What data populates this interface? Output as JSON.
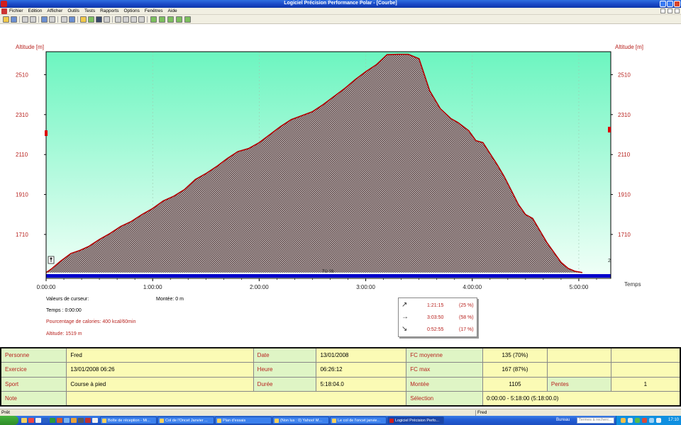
{
  "window": {
    "title": "Logiciel Précision Performance Polar - [Courbe]"
  },
  "menu": [
    "Fichier",
    "Edition",
    "Afficher",
    "Outils",
    "Tests",
    "Rapports",
    "Options",
    "Fenêtres",
    "Aide"
  ],
  "toolbar_icons": [
    "open-icon",
    "save-icon",
    "print-icon",
    "copy-icon",
    "heart-icon",
    "tools-icon",
    "calendar-icon",
    "folder-icon",
    "chart-icon",
    "bar-chart-icon",
    "grid-icon",
    "zoom-icon",
    "zoom-in-icon",
    "zoom-out-icon",
    "image-icon",
    "graph-icon",
    "graph-edit-icon",
    "graph-plus-icon",
    "graph-down-icon",
    "graph-up-icon"
  ],
  "chart_data": {
    "type": "area",
    "ylabel_left": "Altitude [m]",
    "ylabel_right": "Altitude [m]",
    "xlabel": "Temps",
    "yticks": [
      1710,
      1910,
      2110,
      2310,
      2510
    ],
    "xticks": [
      "0:00:00",
      "1:00:00",
      "2:00:00",
      "3:00:00",
      "4:00:00",
      "5:00:00"
    ],
    "ylim": [
      1490,
      2625
    ],
    "xlim_minutes": [
      0,
      318
    ],
    "bar_label": "70 %",
    "right_marker": "2",
    "colors": {
      "line": "#b30000",
      "fill": "#8a7070",
      "bg_top": "#6cf5c0",
      "bg_bottom": "#f2fff8",
      "bar": "#0000cc"
    },
    "series": [
      {
        "x_minutes": [
          0,
          3,
          8,
          14,
          19,
          24,
          30,
          36,
          42,
          48,
          54,
          60,
          66,
          72,
          78,
          84,
          90,
          96,
          102,
          108,
          114,
          120,
          126,
          132,
          138,
          144,
          150,
          156,
          162,
          168,
          174,
          180,
          186,
          192,
          198,
          204,
          210,
          216,
          222,
          228,
          232,
          238,
          242,
          246,
          250,
          254,
          258,
          262,
          266,
          270,
          274,
          278,
          282,
          286,
          290,
          294,
          298,
          302,
          306,
          310,
          314,
          316,
          317
        ],
        "altitude_m": [
          1519,
          1537,
          1575,
          1615,
          1630,
          1650,
          1685,
          1715,
          1750,
          1775,
          1810,
          1840,
          1878,
          1902,
          1935,
          1985,
          2015,
          2050,
          2090,
          2125,
          2140,
          2170,
          2210,
          2250,
          2285,
          2305,
          2325,
          2360,
          2400,
          2440,
          2485,
          2525,
          2560,
          2610,
          2612,
          2612,
          2590,
          2430,
          2340,
          2290,
          2270,
          2230,
          2180,
          2170,
          2115,
          2060,
          2000,
          1930,
          1860,
          1810,
          1790,
          1730,
          1670,
          1620,
          1570,
          1540,
          1525,
          1519
        ]
      }
    ]
  },
  "cursor": {
    "heading": "Valeurs de curseur:",
    "montee": "Montée: 0 m",
    "temps": "Temps : 0:00:00",
    "calories": "Pourcentage de calories: 400 kcal/60min",
    "altitude": "Altitude: 1519 m"
  },
  "slopes": [
    {
      "icon": "up-arrow-icon",
      "time": "1:21:15",
      "pct": "(25 %)"
    },
    {
      "icon": "right-arrow-icon",
      "time": "3:03:50",
      "pct": "(58 %)"
    },
    {
      "icon": "down-arrow-icon",
      "time": "0:52:55",
      "pct": "(17 %)"
    }
  ],
  "summary": {
    "personne_label": "Personne",
    "personne": "Fred",
    "date_label": "Date",
    "date": "13/01/2008",
    "fc_moy_label": "FC moyenne",
    "fc_moy": "135 (70%)",
    "exercice_label": "Exercice",
    "exercice": "13/01/2008 06:26",
    "heure_label": "Heure",
    "heure": "06:26:12",
    "fc_max_label": "FC max",
    "fc_max": "167 (87%)",
    "sport_label": "Sport",
    "sport": "Course à pied",
    "duree_label": "Durée",
    "duree": "5:18:04.0",
    "montee_label": "Montée",
    "montee": "1105",
    "pentes_label": "Pentes",
    "pentes": "1",
    "note_label": "Note",
    "note": "",
    "selection_label": "Sélection",
    "selection": "0:00:00 - 5:18:00 (5:18:00.0)"
  },
  "status": {
    "left": "Prêt",
    "user": "Fred"
  },
  "taskbar": {
    "items": [
      "Boîte de réception - Mi...",
      "Col de l'Oncet  Janvier ...",
      "Plan d'essais",
      "(Non lus : 0) Yahoo! M...",
      "Le col de l'oncet janvie...",
      "Logiciel Précision Perfo..."
    ],
    "bureau": "Bureau",
    "search_placeholder": "Termes à recherc...",
    "clock": "17:10"
  }
}
